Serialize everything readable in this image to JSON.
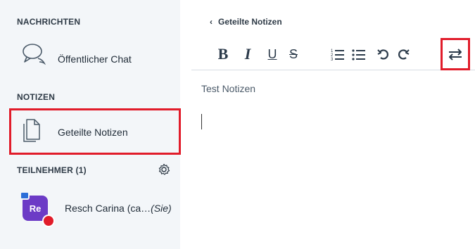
{
  "sidebar": {
    "messages_title": "NACHRICHTEN",
    "public_chat_label": "Öffentlicher Chat",
    "notes_title": "NOTIZEN",
    "shared_notes_label": "Geteilte Notizen",
    "participants_title": "TEILNEHMER (1)",
    "user": {
      "avatar_initials": "Re",
      "name": "Resch Carina (ca…",
      "you_label": "(Sie)"
    }
  },
  "main": {
    "back_label": "Geteilte Notizen",
    "toolbar": {
      "bold": "B",
      "italic": "I",
      "underline": "U",
      "strike": "S"
    },
    "content": "Test Notizen"
  },
  "colors": {
    "highlight": "#e11c2a",
    "avatar": "#6c3bc6",
    "sidebar_bg": "#f3f6f9"
  }
}
